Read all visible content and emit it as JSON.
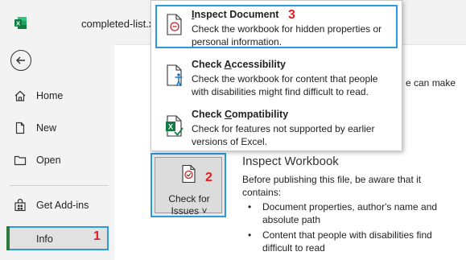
{
  "window": {
    "filename": "completed-list.x",
    "app_icon": "excel-icon"
  },
  "sidebar": {
    "back_icon": "back-arrow-icon",
    "items": [
      {
        "label": "Home",
        "icon": "home-icon"
      },
      {
        "label": "New",
        "icon": "new-document-icon"
      },
      {
        "label": "Open",
        "icon": "open-folder-icon"
      },
      {
        "label": "Get Add-ins",
        "icon": "store-icon"
      },
      {
        "label": "Info",
        "selected": true
      }
    ]
  },
  "menu": {
    "items": [
      {
        "title_prefix": "",
        "title_accel": "I",
        "title_rest": "nspect Document",
        "desc": "Check the workbook for hidden properties or personal information.",
        "icon": "inspect-document-icon"
      },
      {
        "title_prefix": "Check ",
        "title_accel": "A",
        "title_rest": "ccessibility",
        "desc": "Check the workbook for content that people with disabilities might find difficult to read.",
        "icon": "accessibility-icon"
      },
      {
        "title_prefix": "Check ",
        "title_accel": "C",
        "title_rest": "ompatibility",
        "desc": "Check for features not supported by earlier versions of Excel.",
        "icon": "compatibility-icon"
      }
    ]
  },
  "main": {
    "peek_text": "e can make",
    "check_button": {
      "line1": "Check for",
      "line2": "Issues",
      "chevron": "˅",
      "icon": "check-document-icon"
    },
    "inspect": {
      "title": "Inspect Workbook",
      "desc": "Before publishing this file, be aware that it contains:",
      "bullets": [
        "Document properties, author's name and absolute path",
        "Content that people with disabilities find difficult to read"
      ]
    }
  },
  "annotations": {
    "n1": "1",
    "n2": "2",
    "n3": "3",
    "color": "#e31c1c",
    "highlight": "#2a9be0"
  }
}
